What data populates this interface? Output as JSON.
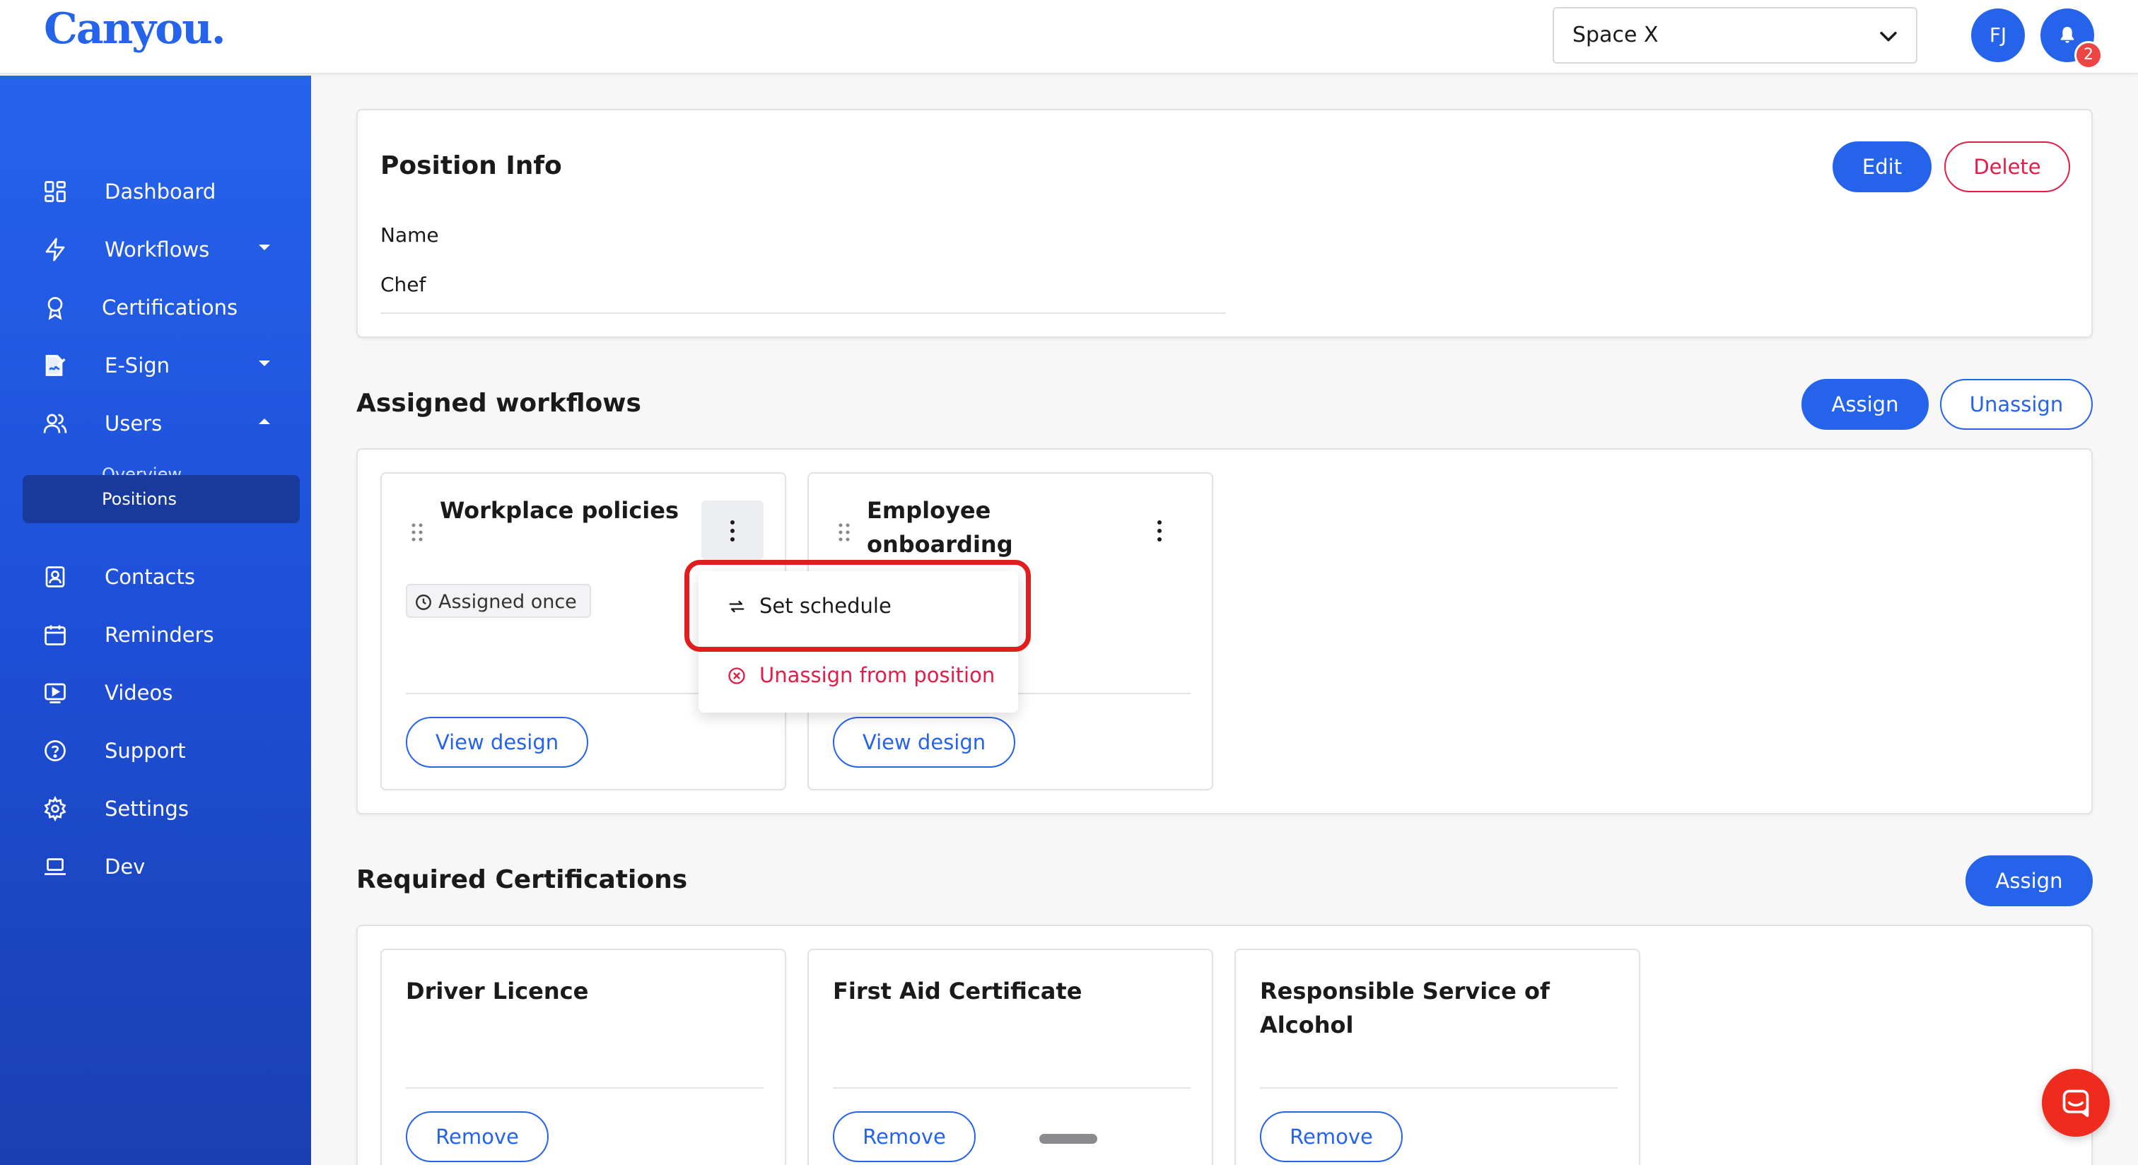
{
  "app": {
    "logo": "Canyou.",
    "space": "Space X",
    "avatar_initials": "FJ",
    "notification_count": "2"
  },
  "sidebar": {
    "items": [
      {
        "label": "Dashboard",
        "icon": "dashboard-icon"
      },
      {
        "label": "Workflows",
        "icon": "lightning-icon"
      },
      {
        "label": "Certifications",
        "icon": "award-icon"
      },
      {
        "label": "E-Sign",
        "icon": "signature-icon"
      },
      {
        "label": "Users",
        "icon": "users-icon"
      },
      {
        "label": "Contacts",
        "icon": "contact-card-icon"
      },
      {
        "label": "Reminders",
        "icon": "calendar-icon"
      },
      {
        "label": "Videos",
        "icon": "video-icon"
      },
      {
        "label": "Support",
        "icon": "help-circle-icon"
      },
      {
        "label": "Settings",
        "icon": "gear-icon"
      },
      {
        "label": "Dev",
        "icon": "laptop-icon"
      }
    ],
    "sub_items": [
      {
        "label": "Overview"
      },
      {
        "label": "Positions"
      }
    ]
  },
  "position_info": {
    "title": "Position Info",
    "edit_label": "Edit",
    "delete_label": "Delete",
    "name_label": "Name",
    "name_value": "Chef"
  },
  "assigned_workflows": {
    "title": "Assigned workflows",
    "assign_label": "Assign",
    "unassign_label": "Unassign",
    "cards": [
      {
        "title": "Workplace policies",
        "tag": "Assigned once",
        "button": "View design"
      },
      {
        "title_line1": "Employee",
        "title_line2": "onboarding",
        "button": "View design"
      }
    ],
    "menu": {
      "set_schedule": "Set schedule",
      "unassign": "Unassign from position"
    }
  },
  "required_certifications": {
    "title": "Required Certifications",
    "assign_label": "Assign",
    "cards": [
      {
        "title": "Driver Licence",
        "button": "Remove"
      },
      {
        "title": "First Aid Certificate",
        "button": "Remove"
      },
      {
        "title_line1": "Responsible Service of",
        "title_line2": "Alcohol",
        "button": "Remove"
      }
    ]
  },
  "colors": {
    "brand": "#2563eb",
    "danger": "#e11d48",
    "highlight": "#e11d1d",
    "chat": "#ef2b1e"
  }
}
